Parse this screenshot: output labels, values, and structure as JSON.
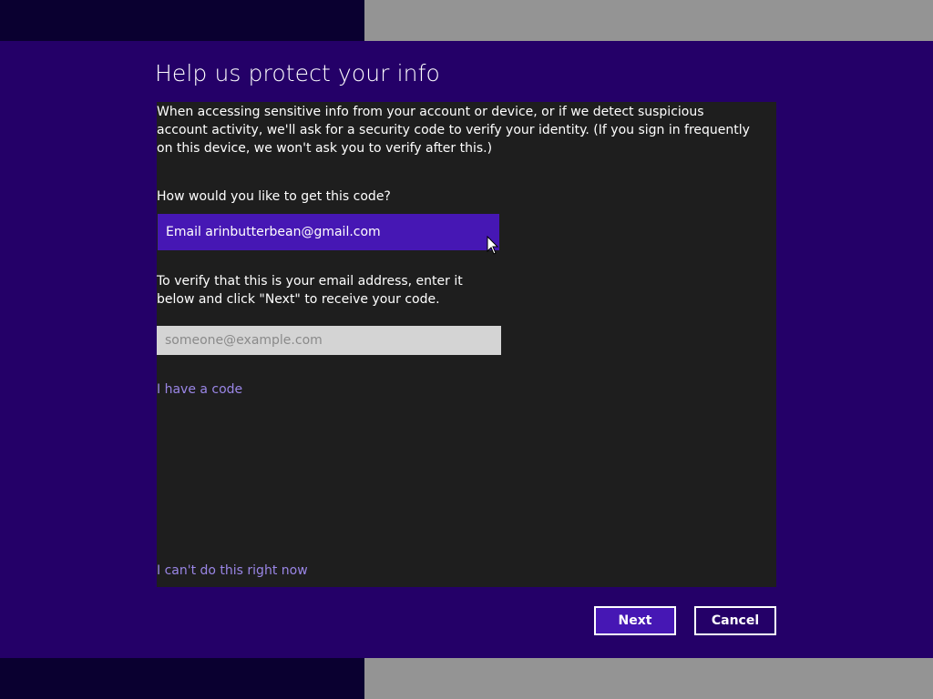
{
  "dialog": {
    "title": "Help us protect your info",
    "description": "When accessing sensitive info from your account or device, or if we detect suspicious account activity, we'll ask for a security code to verify your identity. (If you sign in frequently on this device, we won't ask you to verify after this.)",
    "question": "How would you like to get this code?",
    "method_selected": "Email arinbutterbean@gmail.com",
    "verify_instructions": "To verify that this is your email address, enter it below and click \"Next\" to receive your code.",
    "email_input": {
      "value": "",
      "placeholder": "someone@example.com"
    },
    "have_code_link": "I have a code",
    "cant_do_link": "I can't do this right now",
    "next_button": "Next",
    "cancel_button": "Cancel"
  },
  "colors": {
    "accent": "#4617b4",
    "background": "#240068",
    "panel": "#1e1e1e",
    "link": "#9a86e6"
  }
}
